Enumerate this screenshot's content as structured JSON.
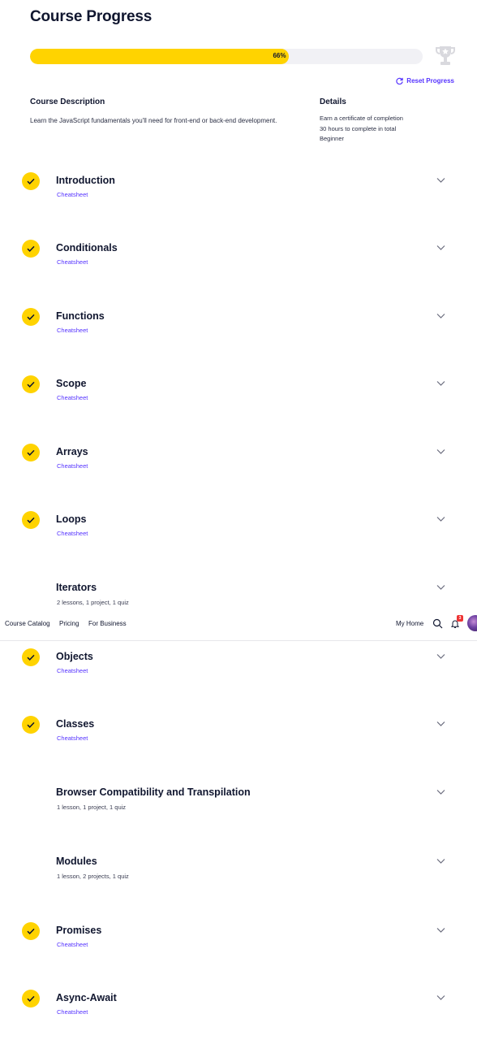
{
  "page": {
    "title": "Course Progress",
    "progress_percent": 66,
    "progress_label": "66%",
    "reset_label": "Reset Progress",
    "accent": "#ffd300",
    "link_color": "#5533ff"
  },
  "description": {
    "heading": "Course Description",
    "text": "Learn the JavaScript fundamentals you'll need for front-end or back-end development."
  },
  "details": {
    "heading": "Details",
    "items": [
      "Earn a certificate of completion",
      "30 hours to complete in total",
      "Beginner"
    ]
  },
  "modules": [
    {
      "title": "Introduction",
      "sub": "Cheatsheet",
      "completed": true
    },
    {
      "title": "Conditionals",
      "sub": "Cheatsheet",
      "completed": true
    },
    {
      "title": "Functions",
      "sub": "Cheatsheet",
      "completed": true
    },
    {
      "title": "Scope",
      "sub": "Cheatsheet",
      "completed": true
    },
    {
      "title": "Arrays",
      "sub": "Cheatsheet",
      "completed": true
    },
    {
      "title": "Loops",
      "sub": "Cheatsheet",
      "completed": true
    },
    {
      "title": "Iterators",
      "sub": "2 lessons, 1 project, 1 quiz",
      "completed": false
    },
    {
      "title": "Objects",
      "sub": "Cheatsheet",
      "completed": true
    },
    {
      "title": "Classes",
      "sub": "Cheatsheet",
      "completed": true
    },
    {
      "title": "Browser Compatibility and Transpilation",
      "sub": "1 lesson, 1 project, 1 quiz",
      "completed": false
    },
    {
      "title": "Modules",
      "sub": "1 lesson, 2 projects, 1 quiz",
      "completed": false
    },
    {
      "title": "Promises",
      "sub": "Cheatsheet",
      "completed": true
    },
    {
      "title": "Async-Await",
      "sub": "Cheatsheet",
      "completed": true
    }
  ],
  "nav": {
    "course_catalog": "Course Catalog",
    "pricing": "Pricing",
    "for_business": "For Business",
    "my_home": "My Home",
    "notification_count": "3"
  }
}
